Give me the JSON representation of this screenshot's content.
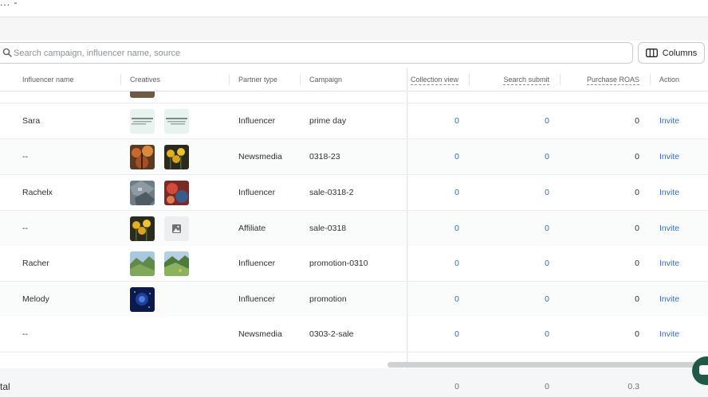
{
  "topbar": {
    "crumb": "... -"
  },
  "search": {
    "placeholder": "Search campaign, influencer name, source",
    "value": ""
  },
  "toolbar": {
    "columns_label": "Columns"
  },
  "columns": {
    "influencer_name": "Influencer name",
    "creatives": "Creatives",
    "partner_type": "Partner type",
    "campaign": "Campaign",
    "collection_view": "Collection view",
    "search_submit": "Search submit",
    "purchase_roas": "Purchase ROAS",
    "action": "Action"
  },
  "rows": [
    {
      "name": "Sara",
      "partner_type": "Influencer",
      "campaign": "prime day",
      "collection_view": "0",
      "search_submit": "0",
      "purchase_roas": "0",
      "action": "Invite",
      "creatives": [
        "text-banner",
        "text-banner"
      ]
    },
    {
      "name": "--",
      "partner_type": "Newsmedia",
      "campaign": "0318-23",
      "collection_view": "0",
      "search_submit": "0",
      "purchase_roas": "0",
      "action": "Invite",
      "creatives": [
        "autumn-forest",
        "sunflowers"
      ]
    },
    {
      "name": "Rachelx",
      "partner_type": "Influencer",
      "campaign": "sale-0318-2",
      "collection_view": "0",
      "search_submit": "0",
      "purchase_roas": "0",
      "action": "Invite",
      "creatives": [
        "aerial-map",
        "abstract-red"
      ]
    },
    {
      "name": "--",
      "partner_type": "Affiliate",
      "campaign": "sale-0318",
      "collection_view": "0",
      "search_submit": "0",
      "purchase_roas": "0",
      "action": "Invite",
      "creatives": [
        "sunflowers",
        "image-placeholder"
      ]
    },
    {
      "name": "Racher",
      "partner_type": "Influencer",
      "campaign": "promotion-0310",
      "collection_view": "0",
      "search_submit": "0",
      "purchase_roas": "0",
      "action": "Invite",
      "creatives": [
        "green-valley",
        "green-valley"
      ]
    },
    {
      "name": "Melody",
      "partner_type": "Influencer",
      "campaign": "promotion",
      "collection_view": "0",
      "search_submit": "0",
      "purchase_roas": "0",
      "action": "Invite",
      "creatives": [
        "night-sky"
      ]
    },
    {
      "name": "--",
      "partner_type": "Newsmedia",
      "campaign": "0303-2-sale",
      "collection_view": "0",
      "search_submit": "0",
      "purchase_roas": "0",
      "action": "Invite",
      "creatives": []
    }
  ],
  "total": {
    "label": "tal",
    "collection_view": "0",
    "search_submit": "0",
    "purchase_roas": "0.3"
  },
  "colors": {
    "link": "#2c6ecb",
    "border": "#c9cccf",
    "chat": "#1f5a47"
  },
  "icons": {
    "search": "search-icon",
    "columns": "columns-icon",
    "chat": "chat-icon",
    "placeholder": "image-placeholder-icon"
  }
}
